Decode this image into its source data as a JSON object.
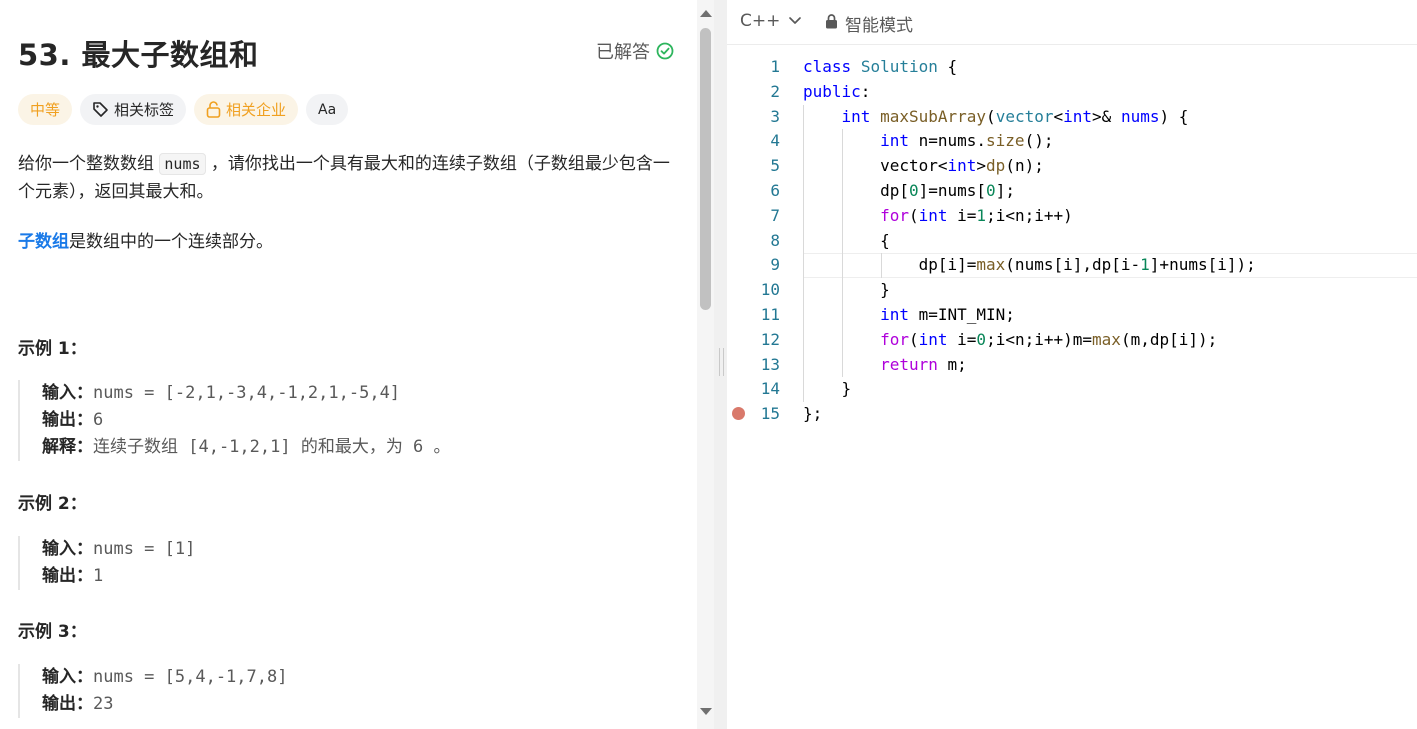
{
  "problem": {
    "title": "53. 最大子数组和",
    "status": "已解答",
    "tags": {
      "difficulty": "中等",
      "related_tags": "相关标签",
      "related_companies": "相关企业",
      "translate_icon": "Aa"
    },
    "description": {
      "part1": "给你一个整数数组 ",
      "code": "nums",
      "part2": " ，请你找出一个具有最大和的连续子数组（子数组最少包含一个元素），返回其最大和。",
      "subarray_link": "子数组",
      "subarray_rest": "是数组中的一个连续部分。"
    },
    "examples": [
      {
        "title": "示例 1：",
        "input_label": "输入：",
        "input": "nums = [-2,1,-3,4,-1,2,1,-5,4]",
        "output_label": "输出：",
        "output": "6",
        "explain_label": "解释：",
        "explain": "连续子数组 [4,-1,2,1] 的和最大，为 6 。"
      },
      {
        "title": "示例 2：",
        "input_label": "输入：",
        "input": "nums = [1]",
        "output_label": "输出：",
        "output": "1"
      },
      {
        "title": "示例 3：",
        "input_label": "输入：",
        "input": "nums = [5,4,-1,7,8]",
        "output_label": "输出：",
        "output": "23"
      }
    ]
  },
  "editor": {
    "language": "C++",
    "mode": "智能模式",
    "line_numbers": [
      "1",
      "2",
      "3",
      "4",
      "5",
      "6",
      "7",
      "8",
      "9",
      "10",
      "11",
      "12",
      "13",
      "14",
      "15"
    ],
    "active_line": 9,
    "breakpoint_line": 15,
    "colors": {
      "keyword": "#0000ff",
      "type": "#267f99",
      "number": "#098658",
      "function": "#795e26",
      "control": "#af00db"
    }
  }
}
